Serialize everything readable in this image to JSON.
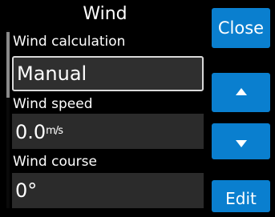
{
  "dialog": {
    "title": "Wind"
  },
  "fields": [
    {
      "label": "Wind calculation",
      "value": "Manual",
      "unit": ""
    },
    {
      "label": "Wind speed",
      "value": "0.0",
      "unit": "m/s"
    },
    {
      "label": "Wind course",
      "value": "0°",
      "unit": ""
    }
  ],
  "buttons": {
    "close": "Close",
    "up_icon": "arrow-up-icon",
    "down_icon": "arrow-down-icon",
    "edit": "Edit"
  },
  "colors": {
    "button": "#0a7fcf",
    "background": "#000000",
    "field": "#2b2b2b"
  }
}
